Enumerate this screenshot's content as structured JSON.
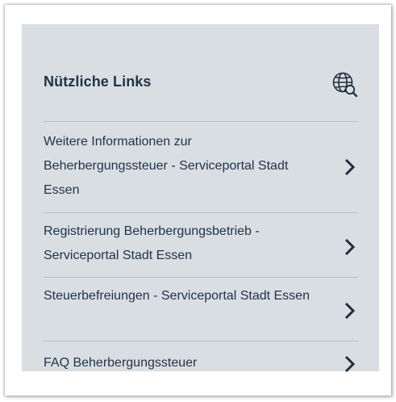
{
  "card": {
    "title": "Nützliche Links",
    "icon": "globe-search-icon",
    "text_color": "#203447",
    "background": "#d9dee3"
  },
  "links": [
    {
      "label": "Weitere Informationen zur Beherbergungssteuer - Serviceportal Stadt Essen",
      "icon": "chevron-right-icon"
    },
    {
      "label": "Registrierung Beherbergungsbetrieb - Serviceportal Stadt Essen",
      "icon": "chevron-right-icon"
    },
    {
      "label": "Steuerbefreiungen - Serviceportal Stadt Essen",
      "icon": "chevron-right-icon"
    },
    {
      "label": "FAQ Beherbergungssteuer",
      "icon": "chevron-right-icon"
    }
  ]
}
